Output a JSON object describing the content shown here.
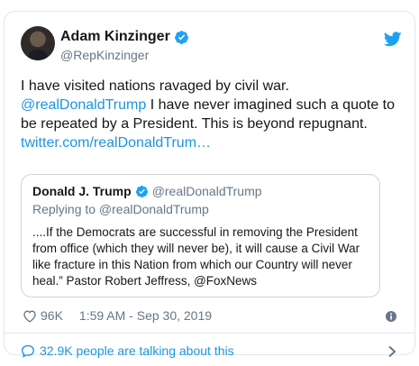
{
  "author": {
    "display_name": "Adam Kinzinger",
    "handle": "@RepKinzinger"
  },
  "tweet": {
    "line1": "I have visited nations ravaged by civil war.",
    "mention": "@realDonaldTrump",
    "line2": " I have never imagined such a quote to be repeated by a President.  This is beyond repugnant.",
    "link": "twitter.com/realDonaldTrum…"
  },
  "quoted": {
    "display_name": "Donald J. Trump",
    "handle": "@realDonaldTrump",
    "replying_to": "Replying to @realDonaldTrump",
    "text": "....If the Democrats are successful in removing the President from office (which they will never be), it will cause a Civil War like fracture in this Nation from which our Country will never heal.” Pastor Robert Jeffress, @FoxNews"
  },
  "meta": {
    "likes": "96K",
    "timestamp": "1:59 AM - Sep 30, 2019"
  },
  "footer": {
    "talking": "32.9K people are talking about this"
  },
  "colors": {
    "link": "#1b95e0",
    "secondary": "#657786",
    "border": "#e1e8ed"
  },
  "icons": [
    "verified-badge-icon",
    "twitter-bird-icon",
    "heart-icon",
    "info-icon",
    "chat-bubble-icon",
    "chevron-right-icon"
  ]
}
